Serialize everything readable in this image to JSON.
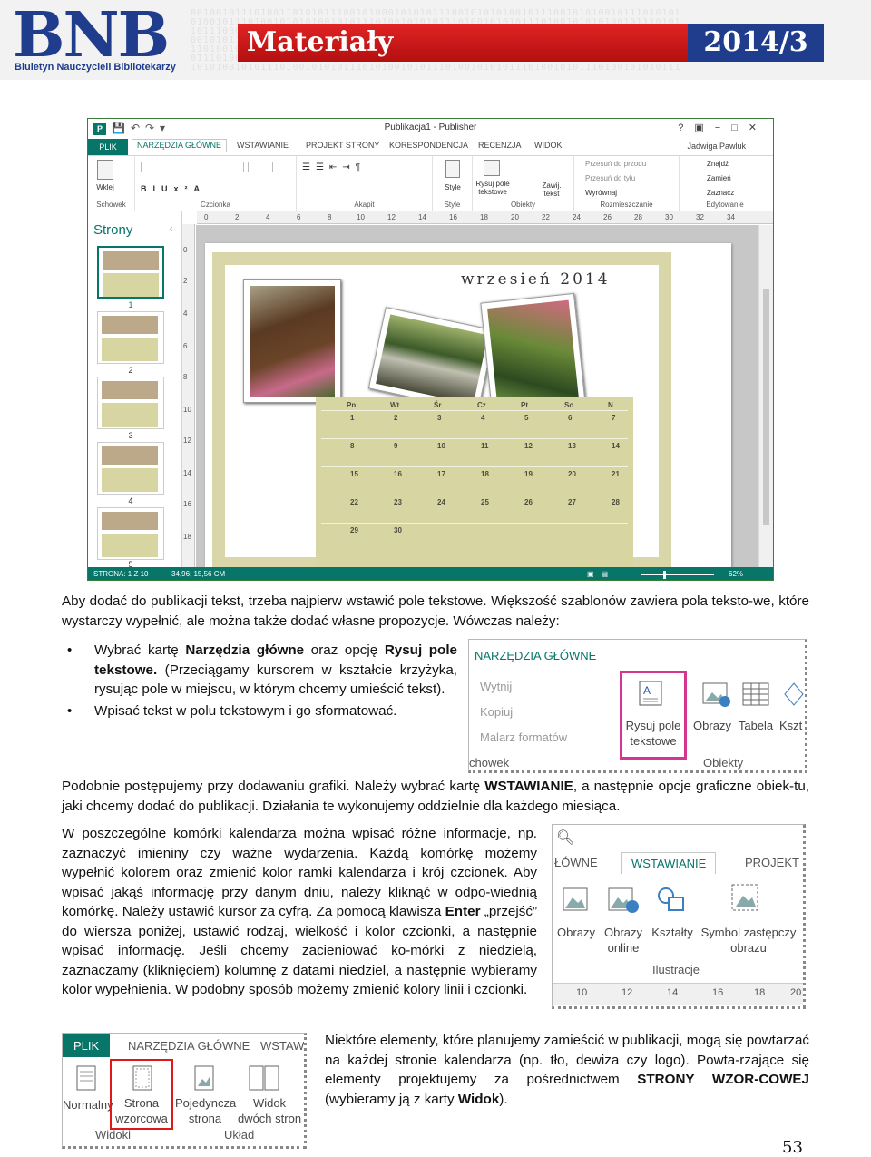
{
  "header": {
    "logo": "BNB",
    "logo_subtitle": "Biuletyn Nauczycieli Bibliotekarzy",
    "section": "Materiały",
    "issue": "2014/3",
    "colors": {
      "brand_blue": "#1f3d8c",
      "brand_red": "#d01c1c"
    }
  },
  "publisher_window": {
    "title": "Publikacja1 - Publisher",
    "tabs": [
      "PLIK",
      "NARZĘDZIA GŁÓWNE",
      "WSTAWIANIE",
      "PROJEKT STRONY",
      "KORESPONDENCJA",
      "RECENZJA",
      "WIDOK"
    ],
    "user": "Jadwiga Pawluk",
    "ribbon": {
      "paste": "Wklej",
      "styles": "Style",
      "draw_text_box": "Rysuj pole tekstowe",
      "wrap_text": "Zawij. tekst",
      "bring_forward": "Przesuń do przodu",
      "send_backward": "Przesuń do tyłu",
      "align": "Wyrównaj",
      "find": "Znajdź",
      "replace": "Zamień",
      "select": "Zaznacz",
      "groups": [
        "Schowek",
        "Czcionka",
        "Akapit",
        "Style",
        "Obiekty",
        "Rozmieszczanie",
        "Edytowanie"
      ]
    },
    "ruler_h": [
      "0",
      "2",
      "4",
      "6",
      "8",
      "10",
      "12",
      "14",
      "16",
      "18",
      "20",
      "22",
      "24",
      "26",
      "28",
      "30",
      "32",
      "34"
    ],
    "ruler_v": [
      "0",
      "2",
      "4",
      "6",
      "8",
      "10",
      "12",
      "14",
      "16",
      "18"
    ],
    "pages_pane_title": "Strony",
    "page_numbers": [
      "1",
      "2",
      "3",
      "4",
      "5"
    ],
    "calendar": {
      "title": "wrzesień 2014",
      "days": [
        "Pn",
        "Wt",
        "Śr",
        "Cz",
        "Pt",
        "So",
        "N"
      ],
      "weeks": [
        [
          "1",
          "2",
          "3",
          "4",
          "5",
          "6",
          "7"
        ],
        [
          "8",
          "9",
          "10",
          "11",
          "12",
          "13",
          "14"
        ],
        [
          "15",
          "16",
          "17",
          "18",
          "19",
          "20",
          "21"
        ],
        [
          "22",
          "23",
          "24",
          "25",
          "26",
          "27",
          "28"
        ],
        [
          "29",
          "30",
          "",
          "",
          "",
          "",
          ""
        ]
      ]
    },
    "status": {
      "page": "STRONA: 1 Z 10",
      "position": "34,96; 15,56 CM",
      "zoom": "62%"
    }
  },
  "text": {
    "intro": "Aby dodać do publikacji tekst, trzeba najpierw wstawić pole tekstowe. Większość szablonów zawiera pola teksto-we, które wystarczy wypełnić, ale można także dodać własne propozycje. Wówczas należy:",
    "bullet1_a": "Wybrać kartę ",
    "bullet1_b": "Narzędzia główne",
    "bullet1_c": " oraz opcję ",
    "bullet1_d": "Rysuj pole tekstowe.",
    "bullet1_e": " (Przeciągamy kursorem w kształcie krzyżyka, rysując pole w miejscu, w którym chcemy umieścić tekst).",
    "bullet2": "Wpisać tekst w polu tekstowym i go sformatować.",
    "graphics_a": "Podobnie postępujemy przy dodawaniu grafiki. Należy wybrać kartę ",
    "graphics_b": "WSTAWIANIE",
    "graphics_c": ", a następnie opcje graficzne obiek-tu, jaki chcemy dodać do publikacji. Działania te wykonujemy oddzielnie dla każdego miesiąca.",
    "cells_a": "W poszczególne komórki kalendarza można wpisać różne informacje, np. zaznaczyć imieniny czy ważne wydarzenia. Każdą komórkę możemy wypełnić kolorem oraz zmienić kolor ramki kalendarza i krój czcionek. Aby wpisać jakąś informację przy danym dniu, należy kliknąć w odpo-wiednią komórkę. Należy ustawić kursor za cyfrą. Za pomocą klawisza ",
    "cells_b": "Enter",
    "cells_c": " „przejść” do wiersza poniżej, ustawić rodzaj, wielkość i kolor czcionki, a następnie wpisać informację. Jeśli chcemy zacieniować ko-mórki z niedzielą, zaznaczamy (kliknięciem) kolumnę z datami niedziel, a następnie wybieramy kolor wypełnienia. W podobny sposób możemy zmienić kolory linii i czcionki.",
    "master_a": "Niektóre elementy, które planujemy zamieścić w publikacji, mogą się powtarzać na każdej stronie kalendarza (np. tło, dewiza czy logo). Powta-rzające się elementy projektujemy za pośrednictwem ",
    "master_b": "STRONY WZOR-COWEJ",
    "master_c": " (wybieramy ją z karty ",
    "master_d": "Widok",
    "master_e": ")."
  },
  "snippet_home": {
    "tab": "NARZĘDZIA GŁÓWNE",
    "cut": "Wytnij",
    "copy": "Kopiuj",
    "format_painter": "Malarz formatów",
    "clipboard": "chowek",
    "draw_text_box": "Rysuj pole tekstowe",
    "pictures": "Obrazy",
    "table": "Tabela",
    "shapes": "Kszt",
    "objects": "Obiekty"
  },
  "snippet_insert": {
    "tab_prev": "ŁÓWNE",
    "tab_active": "WSTAWIANIE",
    "tab_next": "PROJEKT",
    "pictures": "Obrazy",
    "online_pictures": "Obrazy online",
    "shapes": "Kształty",
    "placeholder": "Symbol zastępczy obrazu",
    "group": "Ilustracje",
    "ruler": [
      "10",
      "12",
      "14",
      "16",
      "18",
      "20"
    ]
  },
  "snippet_view": {
    "tab_file": "PLIK",
    "tab_home": "NARZĘDZIA GŁÓWNE",
    "tab_insert": "WSTAW",
    "normal": "Normalny",
    "master_page": "Strona wzorcowa",
    "single_page": "Pojedyncza strona",
    "two_page": "Widok dwóch stron",
    "group_views": "Widoki",
    "group_layout": "Układ"
  },
  "page_number": "53"
}
